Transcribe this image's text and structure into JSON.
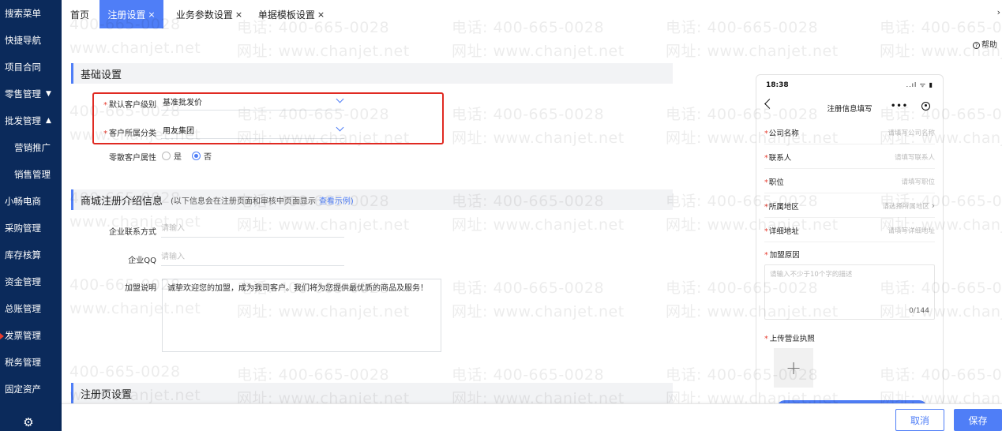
{
  "sidebar": {
    "items": [
      {
        "label": "搜索菜单",
        "arrow": ""
      },
      {
        "label": "快捷导航",
        "arrow": ""
      },
      {
        "label": "项目合同",
        "arrow": ""
      },
      {
        "label": "零售管理",
        "arrow": "▼"
      },
      {
        "label": "批发管理",
        "arrow": "▲"
      },
      {
        "label": "营销推广",
        "arrow": ""
      },
      {
        "label": "销售管理",
        "arrow": ""
      },
      {
        "label": "小畅电商",
        "arrow": ""
      },
      {
        "label": "采购管理",
        "arrow": ""
      },
      {
        "label": "库存核算",
        "arrow": ""
      },
      {
        "label": "资金管理",
        "arrow": ""
      },
      {
        "label": "总账管理",
        "arrow": ""
      },
      {
        "label": "发票管理",
        "arrow": ""
      },
      {
        "label": "税务管理",
        "arrow": ""
      },
      {
        "label": "固定资产",
        "arrow": ""
      }
    ],
    "settings_icon": "gear-icon"
  },
  "tabs": [
    {
      "label": "首页",
      "closable": false,
      "active": false
    },
    {
      "label": "注册设置",
      "closable": true,
      "active": true
    },
    {
      "label": "业务参数设置",
      "closable": true,
      "active": false
    },
    {
      "label": "单据模板设置",
      "closable": true,
      "active": false
    }
  ],
  "close_glyph": "×",
  "tabs_scroll_glyph": "›",
  "help": {
    "icon": "?",
    "label": "帮助"
  },
  "watermark": {
    "phone": "电话: 400-665-0028",
    "phone_short": "400-665-0028",
    "web": "网址: www.chanjet.net",
    "web_short": "www.chanjet.net"
  },
  "sections": {
    "basic": "基础设置",
    "intro": "商城注册介绍信息",
    "intro_note": "(以下信息会在注册页面和审核中页面显示",
    "intro_link": "查看示例)",
    "register_page": "注册页设置"
  },
  "basic": {
    "default_level_label": "默认客户级别",
    "default_level_value": "基准批发价",
    "category_label": "客户所属分类",
    "category_value": "用友集团",
    "retail_label": "零散客户属性",
    "retail_options": [
      "是",
      "否"
    ],
    "retail_selected": "否"
  },
  "intro": {
    "contact_label": "企业联系方式",
    "contact_placeholder": "请输入",
    "qq_label": "企业QQ",
    "qq_placeholder": "请输入",
    "join_label": "加盟说明",
    "join_value": "诚挚欢迎您的加盟，成为我司客户。我们将为您提供最优质的商品及服务！"
  },
  "phone": {
    "time": "18:38",
    "signal": "..ıl ᯤ ▮",
    "title": "注册信息填写",
    "menu_dots": "•••",
    "fields": [
      {
        "label": "公司名称",
        "placeholder": "请填写公司名称",
        "arrow": ""
      },
      {
        "label": "联系人",
        "placeholder": "请填写联系人",
        "arrow": ""
      },
      {
        "label": "职位",
        "placeholder": "请填写职位",
        "arrow": ""
      },
      {
        "label": "所属地区",
        "placeholder": "请选择所属地区",
        "arrow": "›"
      },
      {
        "label": "详细地址",
        "placeholder": "请填写详细地址",
        "arrow": ""
      }
    ],
    "reason_label": "加盟原因",
    "reason_placeholder": "请输入不少于10个字的描述",
    "reason_count": "0/144",
    "license_label": "上传营业执照",
    "upload_glyph": "+"
  },
  "footer": {
    "cancel": "取消",
    "save": "保存"
  },
  "colors": {
    "sidebar": "#0b2a5b",
    "accent": "#4f7ef7",
    "required": "#e63b2e",
    "highlight_box": "#e02a22"
  }
}
